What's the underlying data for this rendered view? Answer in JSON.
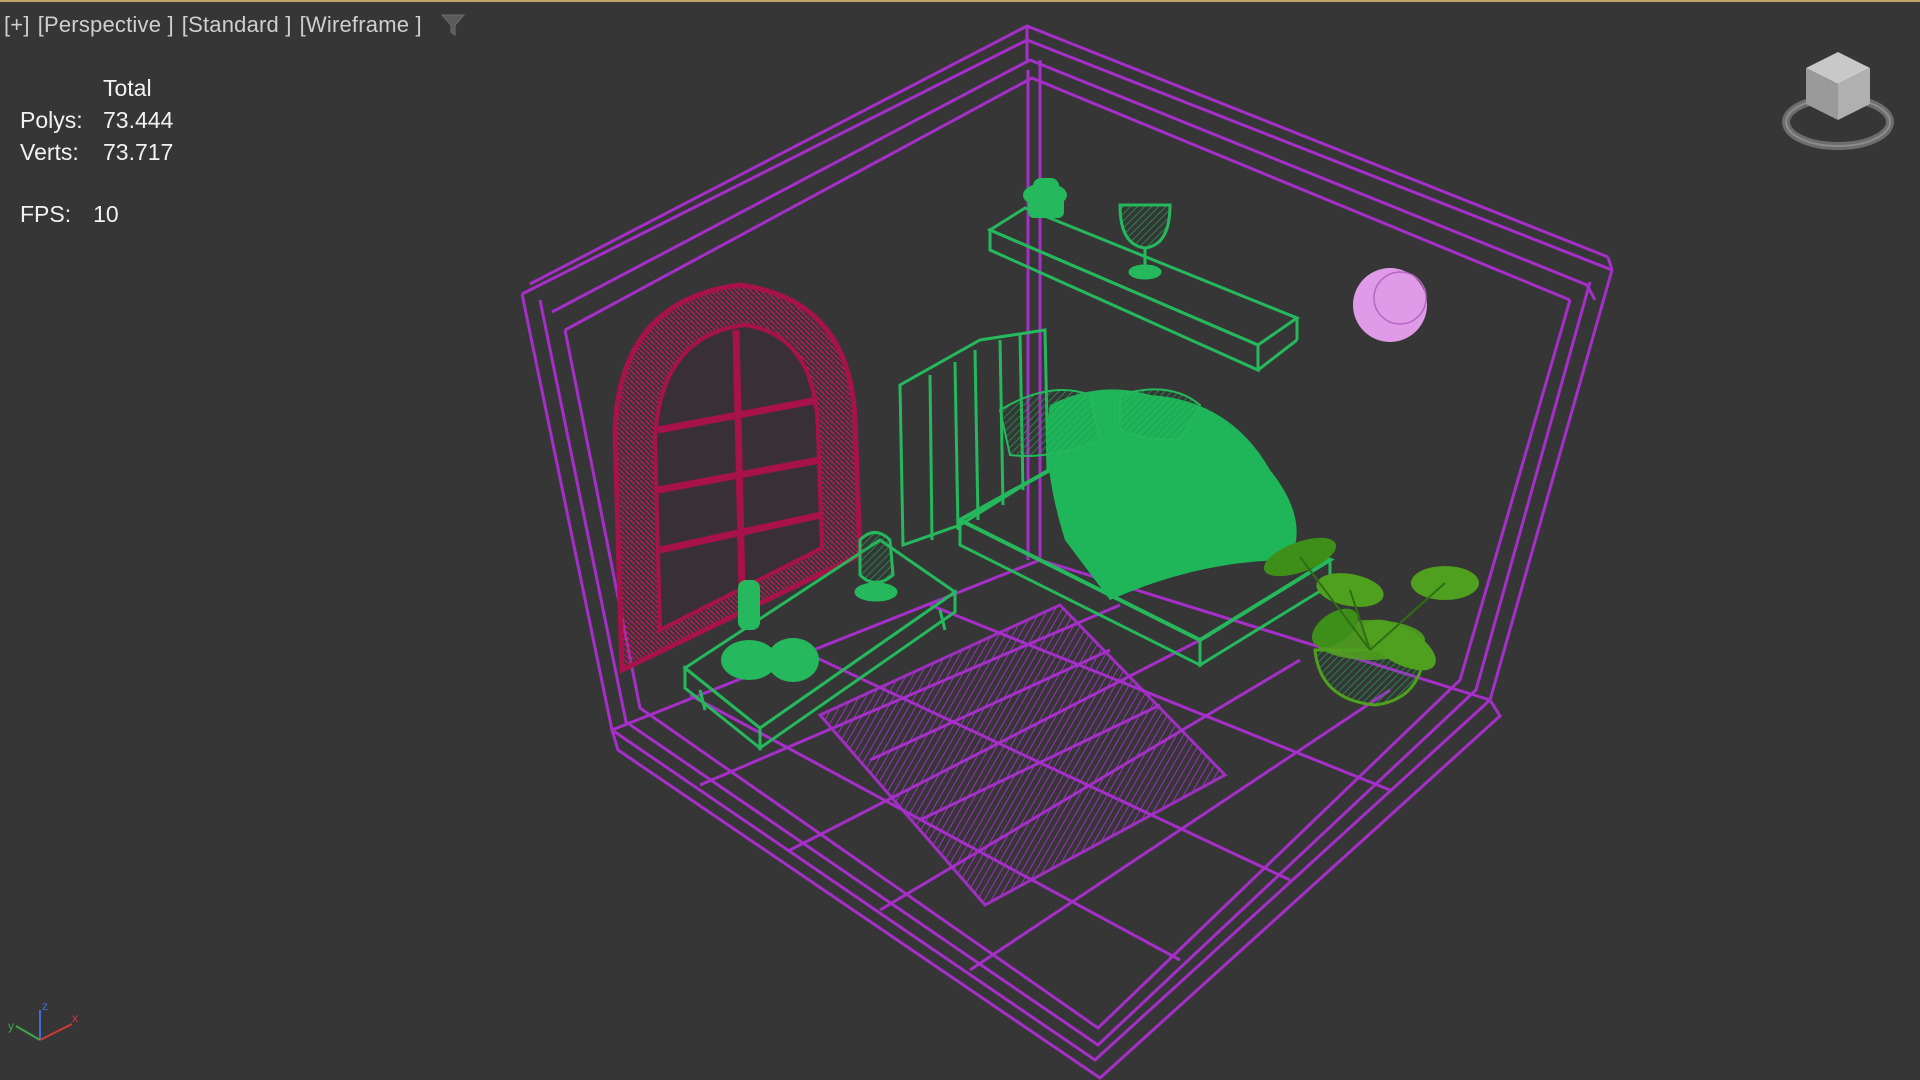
{
  "viewport": {
    "labels": [
      "[+]",
      "[Perspective ]",
      "[Standard ]",
      "[Wireframe ]"
    ],
    "filter_icon": "filter-funnel-icon"
  },
  "stats": {
    "header": "Total",
    "polys_label": "Polys:",
    "polys_value": "73.444",
    "verts_label": "Verts:",
    "verts_value": "73.717",
    "fps_label": "FPS:",
    "fps_value": "10"
  },
  "axis": {
    "x": "x",
    "y": "y",
    "z": "z"
  },
  "colors": {
    "background": "#363636",
    "room_wireframe": "#a52fc8",
    "furniture_wireframe": "#25b85c",
    "window_wireframe": "#a8124a",
    "plant": "#4fa01e",
    "wall_light": "#e09be8"
  }
}
